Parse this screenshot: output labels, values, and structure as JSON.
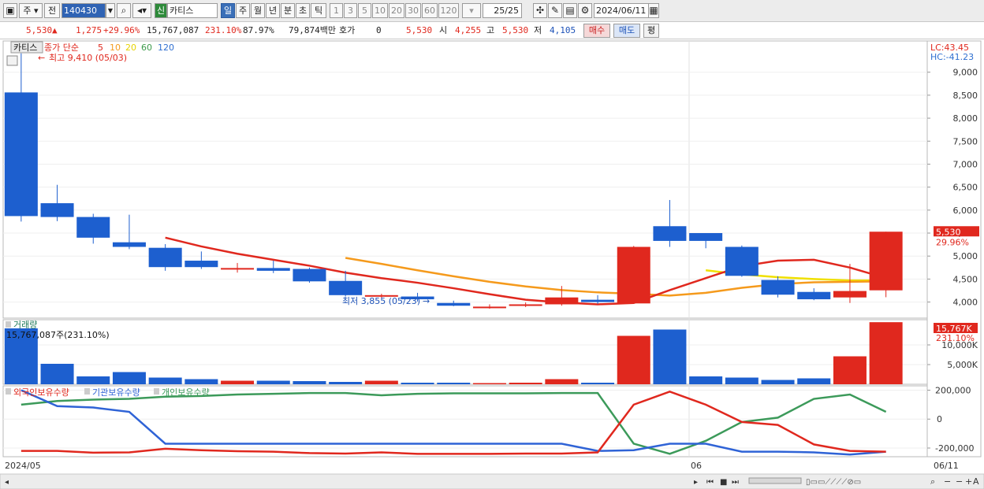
{
  "toolbar": {
    "market": "주",
    "prefix": "전",
    "code": "140430",
    "name_badge": "신",
    "name": "카티스",
    "periods": [
      "일",
      "주",
      "월",
      "년",
      "분",
      "초",
      "틱"
    ],
    "minutes": [
      "1",
      "3",
      "5",
      "10",
      "20",
      "30",
      "60",
      "120"
    ],
    "count": "25/25",
    "date": "2024/06/11"
  },
  "quote": {
    "price": "5,530",
    "change": "1,275",
    "change_pct": "+29.96%",
    "volume": "15,767,087",
    "volume_ratio": "231.10%",
    "turnover": "87.97%",
    "amount": "79,874백만",
    "hoga_label": "호가",
    "hoga_value": "0",
    "hoga_price": "5,530",
    "open_label": "시",
    "open": "4,255",
    "high_label": "고",
    "high": "5,530",
    "low_label": "저",
    "low": "4,105",
    "buy_label": "매수",
    "sell_label": "매도",
    "eval_label": "평"
  },
  "chart_data": {
    "type": "candlestick",
    "title": "카티스",
    "legend": {
      "close_label": "종가 단순",
      "ma": [
        {
          "period": "5",
          "color": "#e0281e"
        },
        {
          "period": "10",
          "color": "#f59a1c"
        },
        {
          "period": "20",
          "color": "#f0e000"
        },
        {
          "period": "60",
          "color": "#3c9a4a"
        },
        {
          "period": "120",
          "color": "#2f6fd0"
        }
      ]
    },
    "highest_label": "최고 9,410 (05/03)",
    "lowest_label": "최저 3,855 (05/23)",
    "lc_label": "LC:43.45",
    "hc_label": "HC:-41.23",
    "price_axis": {
      "ticks": [
        9000,
        8500,
        8000,
        7500,
        7000,
        6500,
        6000,
        5500,
        5000,
        4500,
        4000
      ],
      "tick_labels": [
        "9,000",
        "8,500",
        "8,000",
        "7,500",
        "7,000",
        "6,500",
        "6,000",
        "5,500",
        "5,000",
        "4,500",
        "4,000"
      ],
      "ylim": [
        3650,
        9680
      ]
    },
    "last_price_badge": "5,530",
    "last_pct_label": "29.96%",
    "candles": [
      {
        "o": 8560,
        "h": 9410,
        "l": 5750,
        "c": 5870
      },
      {
        "o": 6150,
        "h": 6550,
        "l": 5760,
        "c": 5850
      },
      {
        "o": 5850,
        "h": 5920,
        "l": 5270,
        "c": 5400
      },
      {
        "o": 5300,
        "h": 5900,
        "l": 5150,
        "c": 5200
      },
      {
        "o": 5180,
        "h": 5260,
        "l": 4680,
        "c": 4760
      },
      {
        "o": 4900,
        "h": 5100,
        "l": 4720,
        "c": 4760
      },
      {
        "o": 4740,
        "h": 4850,
        "l": 4640,
        "c": 4740
      },
      {
        "o": 4740,
        "h": 4900,
        "l": 4630,
        "c": 4680
      },
      {
        "o": 4720,
        "h": 4750,
        "l": 4420,
        "c": 4450
      },
      {
        "o": 4460,
        "h": 4680,
        "l": 4120,
        "c": 4150
      },
      {
        "o": 4130,
        "h": 4180,
        "l": 4080,
        "c": 4150
      },
      {
        "o": 4120,
        "h": 4200,
        "l": 4010,
        "c": 4060
      },
      {
        "o": 3980,
        "h": 4030,
        "l": 3910,
        "c": 3920
      },
      {
        "o": 3890,
        "h": 3950,
        "l": 3855,
        "c": 3900
      },
      {
        "o": 3920,
        "h": 3990,
        "l": 3890,
        "c": 3950
      },
      {
        "o": 3950,
        "h": 4350,
        "l": 3920,
        "c": 4100
      },
      {
        "o": 4050,
        "h": 4150,
        "l": 3960,
        "c": 4000
      },
      {
        "o": 3970,
        "h": 5220,
        "l": 3960,
        "c": 5200
      },
      {
        "o": 5650,
        "h": 6220,
        "l": 5200,
        "c": 5330
      },
      {
        "o": 5500,
        "h": 5500,
        "l": 5170,
        "c": 5330
      },
      {
        "o": 5200,
        "h": 5230,
        "l": 4550,
        "c": 4570
      },
      {
        "o": 4480,
        "h": 4560,
        "l": 4100,
        "c": 4160
      },
      {
        "o": 4220,
        "h": 4300,
        "l": 4040,
        "c": 4060
      },
      {
        "o": 4100,
        "h": 4830,
        "l": 3980,
        "c": 4240
      },
      {
        "o": 4255,
        "h": 5530,
        "l": 4105,
        "c": 5530
      }
    ],
    "ma5": [
      null,
      null,
      null,
      null,
      5400,
      5210,
      5050,
      4920,
      4790,
      4640,
      4520,
      4420,
      4300,
      4170,
      4050,
      3990,
      3950,
      3980,
      4260,
      4520,
      4780,
      4900,
      4920,
      4750,
      4520
    ],
    "ma10": [
      null,
      null,
      null,
      null,
      null,
      null,
      null,
      null,
      null,
      4960,
      4830,
      4690,
      4560,
      4440,
      4340,
      4260,
      4210,
      4180,
      4140,
      4200,
      4310,
      4390,
      4430,
      4440,
      4450
    ],
    "ma20": [
      null,
      null,
      null,
      null,
      null,
      null,
      null,
      null,
      null,
      null,
      null,
      null,
      null,
      null,
      null,
      null,
      null,
      null,
      null,
      4690,
      4600,
      4540,
      4500,
      4470,
      4470
    ],
    "volume_title": "거래량",
    "volume_text": "15,767,087주(231.10%)",
    "volume_badge": "15,767K",
    "volume_pct": "231.10%",
    "volume_axis": {
      "ticks": [
        10000,
        5000
      ],
      "tick_labels": [
        "10,000K",
        "5,000K"
      ],
      "ylim": [
        0,
        16400
      ]
    },
    "volume": [
      14200,
      5200,
      2000,
      3100,
      1700,
      1300,
      900,
      900,
      800,
      600,
      900,
      400,
      400,
      300,
      400,
      1300,
      400,
      12300,
      13900,
      2000,
      1700,
      1100,
      1500,
      7100,
      15767
    ],
    "holdings_legend": [
      "외국인보유수량",
      "기관보유수량",
      "개인보유수량"
    ],
    "holdings_colors": [
      "#e0281e",
      "#2f63d6",
      "#3c9a5a"
    ],
    "holdings_axis": {
      "ticks": [
        200000,
        0,
        -200000
      ],
      "tick_labels": [
        "200,000",
        "0",
        "-200,000"
      ],
      "ylim": [
        -260000,
        230000
      ]
    },
    "foreign": [
      -220000,
      -220000,
      -232000,
      -230000,
      -205000,
      -215000,
      -222000,
      -225000,
      -235000,
      -238000,
      -230000,
      -240000,
      -240000,
      -240000,
      -238000,
      -238000,
      -230000,
      100000,
      190000,
      100000,
      -20000,
      -40000,
      -175000,
      -220000,
      -225000
    ],
    "institution": [
      200000,
      90000,
      80000,
      50000,
      -170000,
      -170000,
      -170000,
      -170000,
      -170000,
      -170000,
      -170000,
      -170000,
      -170000,
      -170000,
      -170000,
      -170000,
      -220000,
      -215000,
      -170000,
      -170000,
      -225000,
      -225000,
      -230000,
      -245000,
      -225000
    ],
    "individual": [
      100000,
      125000,
      135000,
      140000,
      155000,
      160000,
      170000,
      175000,
      180000,
      180000,
      165000,
      175000,
      178000,
      178000,
      178000,
      180000,
      180000,
      -170000,
      -240000,
      -150000,
      -20000,
      10000,
      140000,
      170000,
      50000
    ],
    "date_start": "2024/05",
    "date_mid": "06",
    "date_end": "06/11"
  }
}
